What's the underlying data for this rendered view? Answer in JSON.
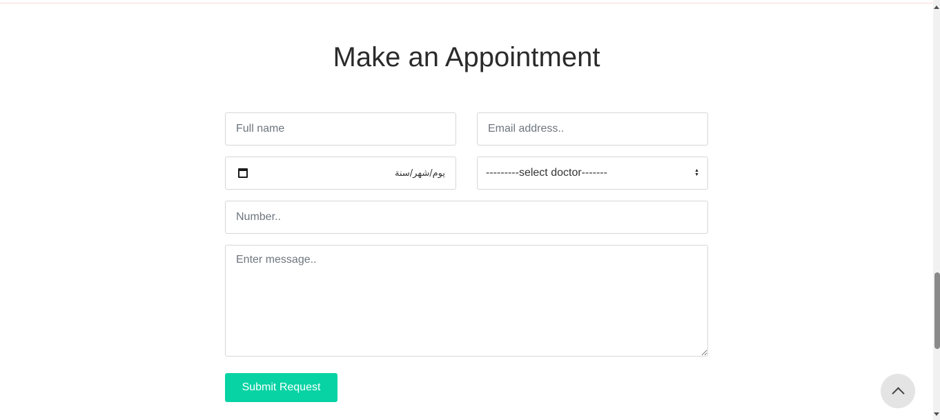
{
  "form": {
    "title": "Make an Appointment",
    "full_name_placeholder": "Full name",
    "email_placeholder": "Email address..",
    "date_value": "يوم/شهر/سنة",
    "doctor_select_value": "---------select doctor-------",
    "number_placeholder": "Number..",
    "message_placeholder": "Enter message..",
    "submit_label": "Submit Request"
  },
  "icons": {
    "date": "calendar-icon",
    "select": "select-arrows-icon",
    "back_to_top": "chevron-up-icon"
  },
  "colors": {
    "accent": "#07d3a4",
    "title": "#2b2b2b",
    "border": "#d6d6d6",
    "back_to_top_bg": "#e4e4e4"
  }
}
